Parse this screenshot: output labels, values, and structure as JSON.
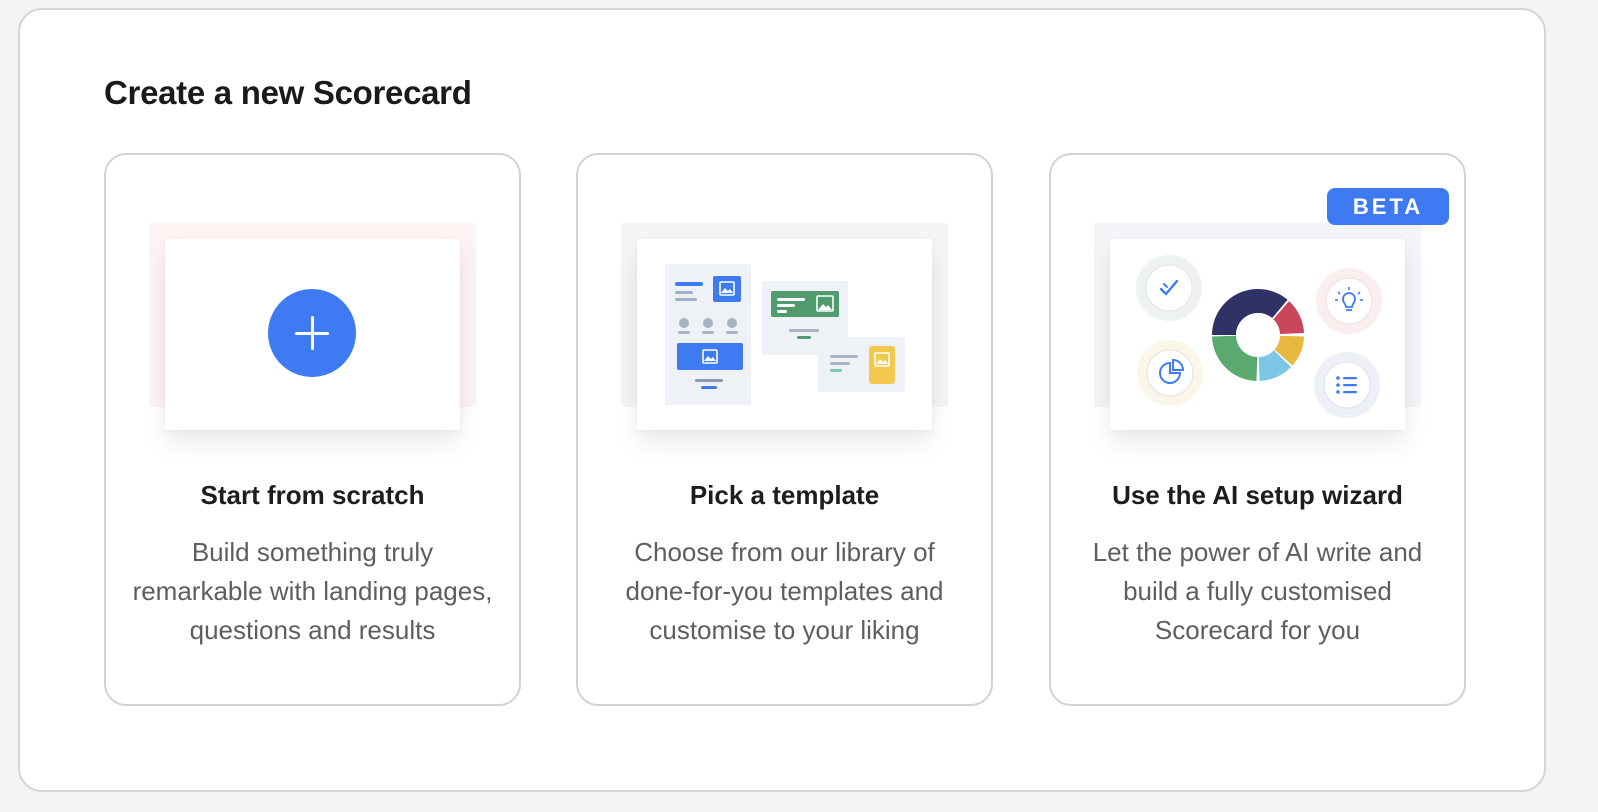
{
  "page": {
    "title": "Create a new Scorecard"
  },
  "cards": [
    {
      "title": "Start from scratch",
      "description": "Build something truly remarkable with landing pages, questions and results",
      "icon": "plus-icon"
    },
    {
      "title": "Pick a template",
      "description": "Choose from our library of done-for-you templates and customise to your liking",
      "icon": "template-illustration"
    },
    {
      "title": "Use the AI setup wizard",
      "description": "Let the power of AI write and build a fully customised Scorecard for you",
      "badge": "BETA",
      "icon": "ai-wizard-illustration"
    }
  ],
  "colors": {
    "accent": "#3e7bf2",
    "green": "#4f9b6e",
    "yellow": "#f2c94c",
    "navy": "#2e3266",
    "red": "#c9465b",
    "sky": "#7cc7e6"
  }
}
